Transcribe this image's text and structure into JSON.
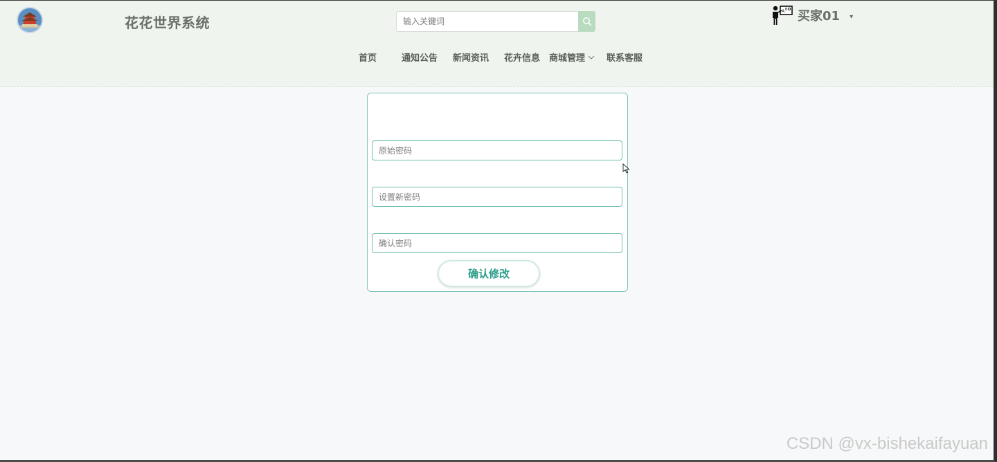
{
  "header": {
    "site_title": "花花世界系统",
    "search_placeholder": "输入关键词",
    "search_icon": "search-icon",
    "user_name": "买家01",
    "user_caret": "▾",
    "accent_color": "#b9dcc0",
    "background_color": "#eff5ee"
  },
  "nav": {
    "items": [
      {
        "label": "首页"
      },
      {
        "label": "通知公告"
      },
      {
        "label": "新闻资讯"
      },
      {
        "label": "花卉信息"
      },
      {
        "label": "商城管理",
        "has_dropdown": true
      },
      {
        "label": "联系客服"
      }
    ]
  },
  "form": {
    "old_password_placeholder": "原始密码",
    "new_password_placeholder": "设置新密码",
    "confirm_password_placeholder": "确认密码",
    "submit_label": "确认修改",
    "border_color": "#7cc4b8",
    "button_text_color": "#2b9d8a"
  },
  "watermark": "CSDN @vx-bishekaifayuan"
}
